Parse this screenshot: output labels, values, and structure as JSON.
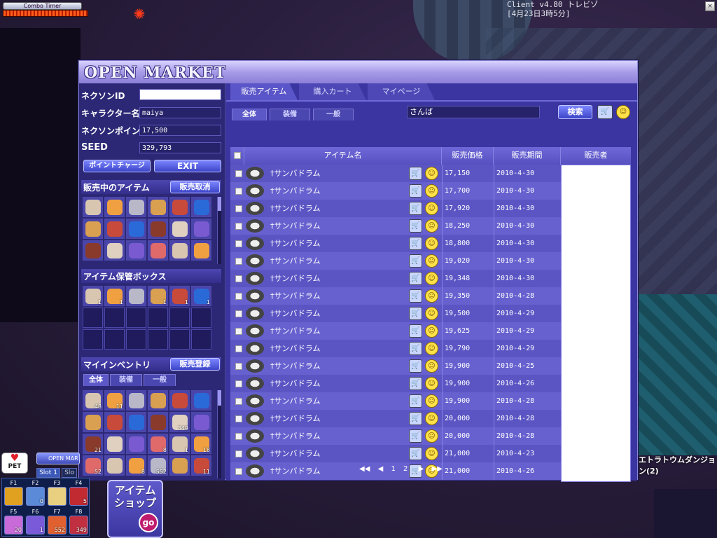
{
  "hud": {
    "combo_timer": "Combo Timer",
    "client_version": "Client v4.80 トレビゾ",
    "client_datetime": "[4月23日3時5分]",
    "close_glyph": "×",
    "area_name": "エトラトウムダンジョン(2)"
  },
  "market": {
    "title": "OPEN MARKET",
    "account": {
      "nexon_id_label": "ネクソンID",
      "nexon_id_value": "",
      "character_label": "キャラクター名",
      "character_value": "maiya",
      "points_label": "ネクソンポイント",
      "points_value": "17,500",
      "seed_label": "SEED",
      "seed_value": "329,793",
      "charge_button": "ポイントチャージ",
      "exit_button": "EXIT"
    },
    "selling": {
      "heading": "販売中のアイテム",
      "cancel_button": "販売取消"
    },
    "storage": {
      "heading": "アイテム保管ボックス",
      "quantities": [
        "1",
        "1",
        "",
        "1",
        "1",
        "1"
      ]
    },
    "inventory": {
      "heading": "マイインベントリ",
      "register_button": "販売登録",
      "tabs": [
        "全体",
        "装備",
        "一般"
      ],
      "quantities": [
        "48",
        "11",
        "",
        "",
        "",
        "",
        "",
        "",
        "",
        "",
        "349",
        "",
        "21",
        "",
        "",
        "8",
        "1",
        "18",
        "52",
        "",
        "8",
        "552",
        "",
        "11"
      ]
    },
    "tabs": [
      "販売アイテム",
      "購入カート",
      "マイページ"
    ],
    "filter_tabs": [
      "全体",
      "装備",
      "一般"
    ],
    "search": {
      "value": "さんば",
      "button": "検索"
    },
    "columns": [
      "アイテム名",
      "販売価格",
      "販売期間",
      "販売者"
    ],
    "rows": [
      {
        "name": "†サンバドラム",
        "price": "17,150",
        "date": "2010-4-30"
      },
      {
        "name": "†サンバドラム",
        "price": "17,700",
        "date": "2010-4-30"
      },
      {
        "name": "†サンバドラム",
        "price": "17,920",
        "date": "2010-4-30"
      },
      {
        "name": "†サンバドラム",
        "price": "18,250",
        "date": "2010-4-30"
      },
      {
        "name": "†サンバドラム",
        "price": "18,800",
        "date": "2010-4-30"
      },
      {
        "name": "†サンバドラム",
        "price": "19,020",
        "date": "2010-4-30"
      },
      {
        "name": "†サンバドラム",
        "price": "19,348",
        "date": "2010-4-30"
      },
      {
        "name": "†サンバドラム",
        "price": "19,350",
        "date": "2010-4-28"
      },
      {
        "name": "†サンバドラム",
        "price": "19,500",
        "date": "2010-4-29"
      },
      {
        "name": "†サンバドラム",
        "price": "19,625",
        "date": "2010-4-29"
      },
      {
        "name": "†サンバドラム",
        "price": "19,790",
        "date": "2010-4-29"
      },
      {
        "name": "†サンバドラム",
        "price": "19,900",
        "date": "2010-4-25"
      },
      {
        "name": "†サンバドラム",
        "price": "19,900",
        "date": "2010-4-26"
      },
      {
        "name": "†サンバドラム",
        "price": "19,900",
        "date": "2010-4-28"
      },
      {
        "name": "†サンバドラム",
        "price": "20,000",
        "date": "2010-4-28"
      },
      {
        "name": "†サンバドラム",
        "price": "20,000",
        "date": "2010-4-28"
      },
      {
        "name": "†サンバドラム",
        "price": "21,000",
        "date": "2010-4-23"
      },
      {
        "name": "†サンバドラム",
        "price": "21,000",
        "date": "2010-4-26"
      }
    ],
    "pager": {
      "first": "◀◀",
      "prev": "◀",
      "pages": [
        "1",
        "2"
      ],
      "next": "▶",
      "last": "▶▶"
    }
  },
  "bottom": {
    "pet_label": "PET",
    "task_label": "OPEN MAR",
    "slot_tabs": [
      "Slot 1",
      "Slo"
    ],
    "hotkeys": [
      {
        "key": "F1",
        "qty": ""
      },
      {
        "key": "F2",
        "qty": "0"
      },
      {
        "key": "F3",
        "qty": ""
      },
      {
        "key": "F4",
        "qty": "5"
      },
      {
        "key": "F5",
        "qty": "20"
      },
      {
        "key": "F6",
        "qty": "1"
      },
      {
        "key": "F7",
        "qty": "552"
      },
      {
        "key": "F8",
        "qty": "349"
      }
    ],
    "shop_title": "アイテムショップ",
    "shop_go": "go"
  },
  "colors": {
    "window_bg": "#2f2a7a",
    "row_a": "#5b55c4",
    "row_b": "#6761cf",
    "accent": "#8a86d8"
  }
}
